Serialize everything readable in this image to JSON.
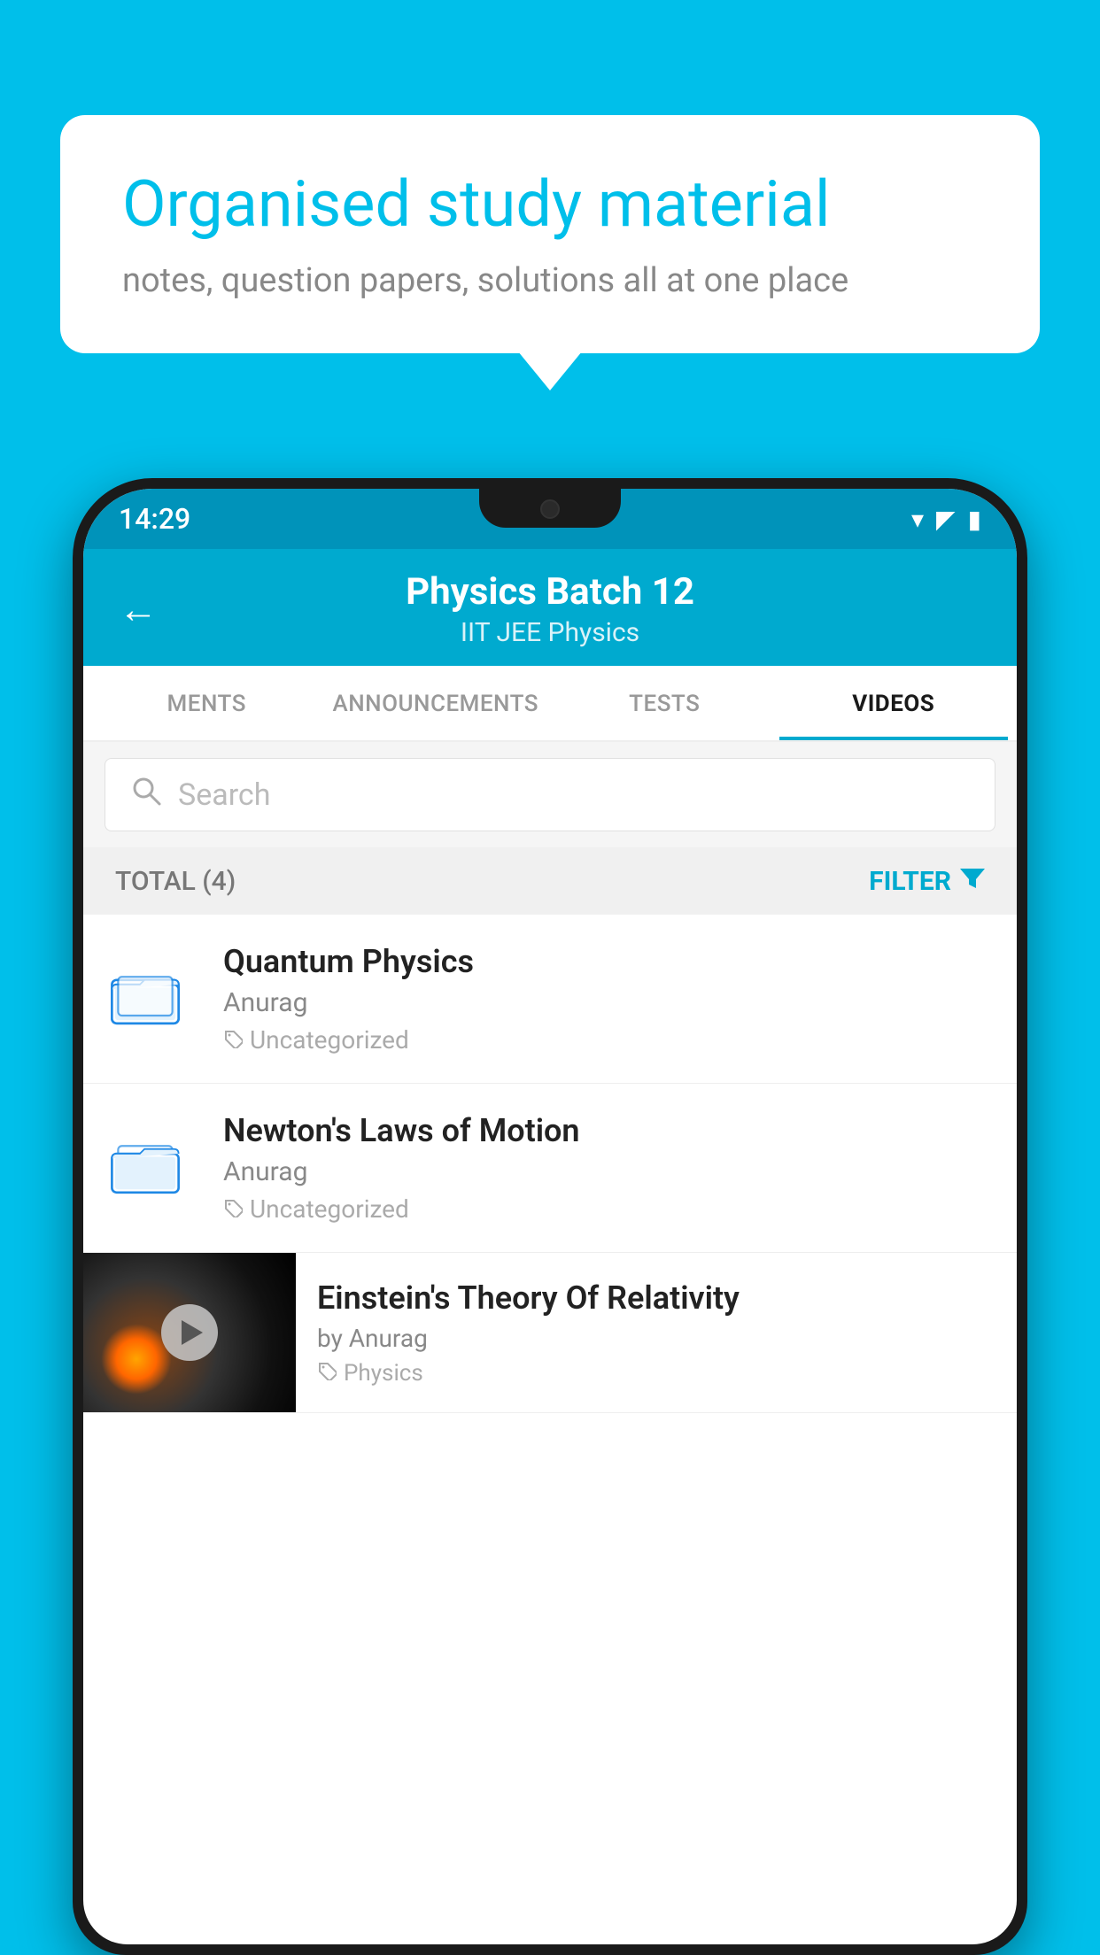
{
  "background_color": "#00BFEA",
  "speech_bubble": {
    "title": "Organised study material",
    "subtitle": "notes, question papers, solutions all at one place"
  },
  "status_bar": {
    "time": "14:29",
    "wifi": "▾",
    "signal": "▲",
    "battery": "▮"
  },
  "header": {
    "back_label": "←",
    "title": "Physics Batch 12",
    "subtitle": "IIT JEE   Physics"
  },
  "tabs": [
    {
      "label": "MENTS",
      "active": false
    },
    {
      "label": "ANNOUNCEMENTS",
      "active": false
    },
    {
      "label": "TESTS",
      "active": false
    },
    {
      "label": "VIDEOS",
      "active": true
    }
  ],
  "search": {
    "placeholder": "Search"
  },
  "filter_bar": {
    "total_label": "TOTAL (4)",
    "filter_label": "FILTER"
  },
  "videos": [
    {
      "id": 1,
      "title": "Quantum Physics",
      "author": "Anurag",
      "tag": "Uncategorized",
      "type": "folder"
    },
    {
      "id": 2,
      "title": "Newton's Laws of Motion",
      "author": "Anurag",
      "tag": "Uncategorized",
      "type": "folder"
    },
    {
      "id": 3,
      "title": "Einstein's Theory Of Relativity",
      "author": "by Anurag",
      "tag": "Physics",
      "type": "thumbnail"
    }
  ]
}
